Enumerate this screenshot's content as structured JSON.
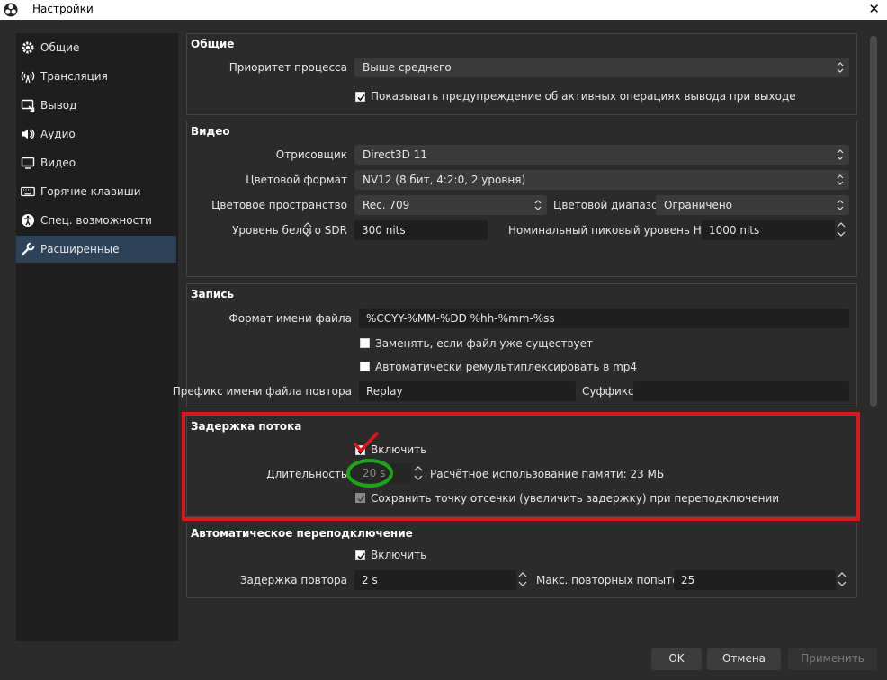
{
  "window": {
    "title": "Настройки"
  },
  "sidebar": {
    "items": [
      {
        "label": "Общие",
        "icon": "gear-icon"
      },
      {
        "label": "Трансляция",
        "icon": "broadcast-icon"
      },
      {
        "label": "Вывод",
        "icon": "output-icon"
      },
      {
        "label": "Аудио",
        "icon": "speaker-icon"
      },
      {
        "label": "Видео",
        "icon": "monitor-icon"
      },
      {
        "label": "Горячие клавиши",
        "icon": "keyboard-icon"
      },
      {
        "label": "Спец. возможности",
        "icon": "accessibility-icon"
      },
      {
        "label": "Расширенные",
        "icon": "wrench-icon",
        "active": true
      }
    ]
  },
  "general": {
    "title": "Общие",
    "priority_label": "Приоритет процесса",
    "priority_value": "Выше среднего",
    "warn_label": "Показывать предупреждение об активных операциях вывода при выходе",
    "warn_checked": true
  },
  "video": {
    "title": "Видео",
    "renderer_label": "Отрисовщик",
    "renderer_value": "Direct3D 11",
    "color_format_label": "Цветовой формат",
    "color_format_value": "NV12 (8 бит, 4:2:0, 2 уровня)",
    "color_space_label": "Цветовое пространство",
    "color_space_value": "Rec. 709",
    "color_range_label": "Цветовой диапазон",
    "color_range_value": "Ограничено",
    "sdr_white_label": "Уровень белого SDR",
    "sdr_white_value": "300 nits",
    "hdr_peak_label": "Номинальный пиковый уровень HDR",
    "hdr_peak_value": "1000 nits"
  },
  "recording": {
    "title": "Запись",
    "filename_format_label": "Формат имени файла",
    "filename_format_value": "%CCYY-%MM-%DD %hh-%mm-%ss",
    "overwrite_label": "Заменять, если файл уже существует",
    "overwrite_checked": false,
    "remux_label": "Автоматически ремультиплексировать в mp4",
    "remux_checked": false,
    "replay_prefix_label": "Префикс имени файла повтора",
    "replay_prefix_value": "Replay",
    "suffix_label": "Суффикс",
    "suffix_value": ""
  },
  "stream_delay": {
    "title": "Задержка потока",
    "enable_label": "Включить",
    "enable_checked": true,
    "duration_label": "Длительность",
    "duration_value": "20 s",
    "memory_label": "Расчётное использование памяти: 23 МБ",
    "preserve_label": "Сохранить точку отсечки (увеличить задержку) при переподключении",
    "preserve_checked": true
  },
  "reconnect": {
    "title": "Автоматическое переподключение",
    "enable_label": "Включить",
    "enable_checked": true,
    "retry_delay_label": "Задержка повтора",
    "retry_delay_value": "2 s",
    "max_retries_label": "Макс. повторных попыток",
    "max_retries_value": "25"
  },
  "buttons": {
    "ok": "OK",
    "cancel": "Отмена",
    "apply": "Применить"
  },
  "colors": {
    "highlight_box": "#e0141c",
    "circle_mark": "#1aa51a",
    "check_mark": "#e0141c",
    "active_item": "#2d4258"
  }
}
